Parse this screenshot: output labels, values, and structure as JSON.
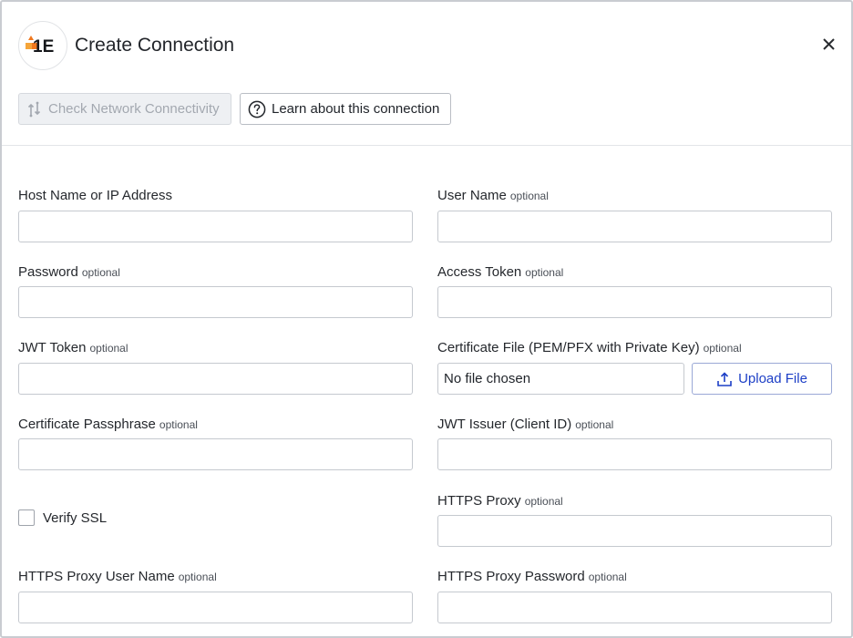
{
  "dialog": {
    "title": "Create Connection",
    "logo_text": "1E",
    "toolbar": {
      "check_label": "Check Network Connectivity",
      "learn_label": "Learn about this connection"
    }
  },
  "optional_tag": "optional",
  "fields": {
    "host": {
      "label": "Host Name or IP Address",
      "value": ""
    },
    "username": {
      "label": "User Name",
      "value": ""
    },
    "password": {
      "label": "Password",
      "value": ""
    },
    "access_token": {
      "label": "Access Token",
      "value": ""
    },
    "jwt_token": {
      "label": "JWT Token",
      "value": ""
    },
    "certificate_file": {
      "label": "Certificate File (PEM/PFX with Private Key)",
      "status": "No file chosen",
      "upload_label": "Upload File"
    },
    "cert_passphrase": {
      "label": "Certificate Passphrase",
      "value": ""
    },
    "jwt_issuer": {
      "label": "JWT Issuer (Client ID)",
      "value": ""
    },
    "verify_ssl": {
      "label": "Verify SSL",
      "checked": false
    },
    "https_proxy": {
      "label": "HTTPS Proxy",
      "value": ""
    },
    "proxy_username": {
      "label": "HTTPS Proxy User Name",
      "value": ""
    },
    "proxy_password": {
      "label": "HTTPS Proxy Password",
      "value": ""
    }
  },
  "colors": {
    "brand_orange": "#f0781e",
    "brand_dark": "#15171a",
    "link_blue": "#1c3ec6"
  }
}
